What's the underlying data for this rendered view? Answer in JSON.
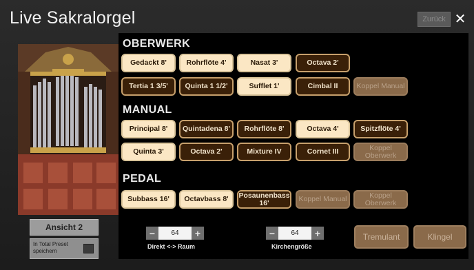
{
  "header": {
    "title": "Live Sakralorgel",
    "back_label": "Zurück",
    "close_label": "✕"
  },
  "left": {
    "view_button": "Ansicht 2",
    "preset_label": "In Total Preset speichern"
  },
  "sections": {
    "oberwerk": {
      "title": "OBERWERK",
      "stops": [
        {
          "label": "Gedackt 8'",
          "state": "on"
        },
        {
          "label": "Rohrflöte 4'",
          "state": "on"
        },
        {
          "label": "Nasat 3'",
          "state": "on"
        },
        {
          "label": "Octava 2'",
          "state": "off"
        },
        {
          "label": "Tertia 1 3/5'",
          "state": "off"
        },
        {
          "label": "Quinta 1 1/2'",
          "state": "off"
        },
        {
          "label": "Sufflet 1'",
          "state": "on"
        },
        {
          "label": "Cimbal II",
          "state": "off"
        },
        {
          "label": "Koppel Manual",
          "state": "disabled"
        }
      ]
    },
    "manual": {
      "title": "MANUAL",
      "stops": [
        {
          "label": "Principal 8'",
          "state": "on"
        },
        {
          "label": "Quintadena 8'",
          "state": "off"
        },
        {
          "label": "Rohrflöte 8'",
          "state": "off"
        },
        {
          "label": "Octava 4'",
          "state": "on"
        },
        {
          "label": "Spitzflöte 4'",
          "state": "off"
        },
        {
          "label": "Quinta 3'",
          "state": "on"
        },
        {
          "label": "Octava 2'",
          "state": "off"
        },
        {
          "label": "Mixture IV",
          "state": "off"
        },
        {
          "label": "Cornet III",
          "state": "off"
        },
        {
          "label": "Koppel Oberwerk",
          "state": "disabled"
        }
      ]
    },
    "pedal": {
      "title": "PEDAL",
      "stops": [
        {
          "label": "Subbass 16'",
          "state": "on"
        },
        {
          "label": "Octavbass 8'",
          "state": "on"
        },
        {
          "label": "Posaunenbass 16'",
          "state": "off"
        },
        {
          "label": "Koppel Manual",
          "state": "disabled"
        },
        {
          "label": "Koppel Oberwerk",
          "state": "disabled"
        }
      ]
    }
  },
  "controls": {
    "direkt_raum": {
      "value": "64",
      "label": "Direkt <-> Raum",
      "minus": "−",
      "plus": "+"
    },
    "kirchengroesse": {
      "value": "64",
      "label": "Kirchengröße",
      "minus": "−",
      "plus": "+"
    },
    "tremulant": "Tremulant",
    "klingel": "Klingel"
  },
  "colors": {
    "stop_on": "#fbe7c4",
    "stop_off": "#3a2008",
    "stop_disabled": "#8a6a4a",
    "panel": "#000000"
  }
}
